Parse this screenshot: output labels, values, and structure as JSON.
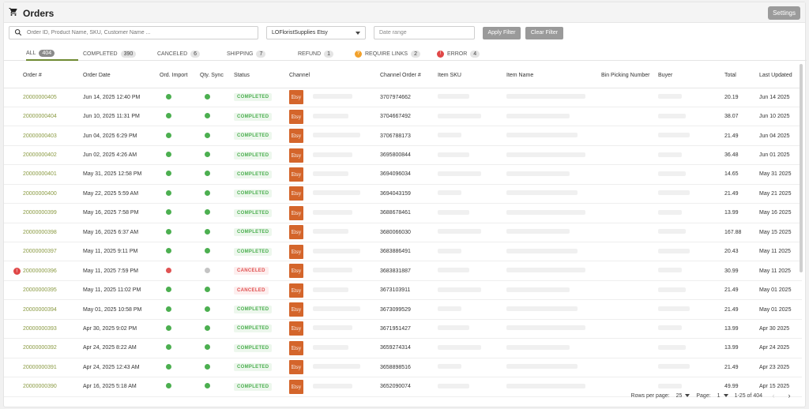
{
  "header": {
    "title": "Orders",
    "settings_label": "Settings"
  },
  "filters": {
    "search_placeholder": "Order ID, Product Name, SKU, Customer Name ...",
    "store_value": "LOFloristSupplies Etsy",
    "date_placeholder": "Date range",
    "apply_label": "Apply Filter",
    "clear_label": "Clear Filter"
  },
  "tabs": [
    {
      "label": "ALL",
      "count": "404"
    },
    {
      "label": "COMPLETED",
      "count": "390"
    },
    {
      "label": "CANCELED",
      "count": "6"
    },
    {
      "label": "SHIPPING",
      "count": "7"
    },
    {
      "label": "REFUND",
      "count": "1"
    },
    {
      "label": "REQUIRE LINKS",
      "count": "2"
    },
    {
      "label": "ERROR",
      "count": "4"
    }
  ],
  "columns": {
    "order": "Order #",
    "order_date": "Order Date",
    "ord_import": "Ord. Import",
    "qty_sync": "Qty. Sync",
    "status": "Status",
    "channel": "Channel",
    "channel_order": "Channel Order #",
    "item_sku": "Item SKU",
    "item_name": "Item Name",
    "bin": "Bin Picking Number",
    "buyer": "Buyer",
    "total": "Total",
    "updated": "Last Updated"
  },
  "channel_logo_text": "Etsy",
  "rows": [
    {
      "order": "20000000405",
      "date": "Jun 14, 2025 12:40 PM",
      "imp": "green",
      "sync": "green",
      "status": "COMPLETED",
      "ch_order": "3707974662",
      "total": "20.19",
      "updated": "Jun 14 2025"
    },
    {
      "order": "20000000404",
      "date": "Jun 10, 2025 11:31 PM",
      "imp": "green",
      "sync": "green",
      "status": "COMPLETED",
      "ch_order": "3704667492",
      "total": "38.07",
      "updated": "Jun 10 2025"
    },
    {
      "order": "20000000403",
      "date": "Jun 04, 2025 6:29 PM",
      "imp": "green",
      "sync": "green",
      "status": "COMPLETED",
      "ch_order": "3706788173",
      "total": "21.49",
      "updated": "Jun 04 2025"
    },
    {
      "order": "20000000402",
      "date": "Jun 02, 2025 4:26 AM",
      "imp": "green",
      "sync": "green",
      "status": "COMPLETED",
      "ch_order": "3695800844",
      "total": "36.48",
      "updated": "Jun 01 2025"
    },
    {
      "order": "20000000401",
      "date": "May 31, 2025 12:58 PM",
      "imp": "green",
      "sync": "green",
      "status": "COMPLETED",
      "ch_order": "3694096034",
      "total": "14.65",
      "updated": "May 31 2025"
    },
    {
      "order": "20000000400",
      "date": "May 22, 2025 5:59 AM",
      "imp": "green",
      "sync": "green",
      "status": "COMPLETED",
      "ch_order": "3694043159",
      "total": "21.49",
      "updated": "May 21 2025"
    },
    {
      "order": "20000000399",
      "date": "May 16, 2025 7:58 PM",
      "imp": "green",
      "sync": "green",
      "status": "COMPLETED",
      "ch_order": "3688678461",
      "total": "13.99",
      "updated": "May 16 2025"
    },
    {
      "order": "20000000398",
      "date": "May 16, 2025 6:37 AM",
      "imp": "green",
      "sync": "green",
      "status": "COMPLETED",
      "ch_order": "3680066030",
      "total": "167.88",
      "updated": "May 15 2025"
    },
    {
      "order": "20000000397",
      "date": "May 11, 2025 9:11 PM",
      "imp": "green",
      "sync": "green",
      "status": "COMPLETED",
      "ch_order": "3683886491",
      "total": "20.43",
      "updated": "May 11 2025"
    },
    {
      "order": "20000000396",
      "date": "May 11, 2025 7:59 PM",
      "imp": "red",
      "sync": "gray",
      "status": "CANCELED",
      "ch_order": "3683831887",
      "total": "30.99",
      "updated": "May 11 2025",
      "error": true
    },
    {
      "order": "20000000395",
      "date": "May 11, 2025 11:02 PM",
      "imp": "green",
      "sync": "green",
      "status": "CANCELED",
      "ch_order": "3673103911",
      "total": "21.49",
      "updated": "May 01 2025"
    },
    {
      "order": "20000000394",
      "date": "May 01, 2025 10:58 PM",
      "imp": "green",
      "sync": "green",
      "status": "COMPLETED",
      "ch_order": "3673099529",
      "total": "21.49",
      "updated": "May 01 2025"
    },
    {
      "order": "20000000393",
      "date": "Apr 30, 2025 9:02 PM",
      "imp": "green",
      "sync": "green",
      "status": "COMPLETED",
      "ch_order": "3671951427",
      "total": "13.99",
      "updated": "Apr 30 2025"
    },
    {
      "order": "20000000392",
      "date": "Apr 24, 2025 8:22 AM",
      "imp": "green",
      "sync": "green",
      "status": "COMPLETED",
      "ch_order": "3659274314",
      "total": "13.99",
      "updated": "Apr 24 2025"
    },
    {
      "order": "20000000391",
      "date": "Apr 24, 2025 12:43 AM",
      "imp": "green",
      "sync": "green",
      "status": "COMPLETED",
      "ch_order": "3658898516",
      "total": "21.49",
      "updated": "Apr 23 2025"
    },
    {
      "order": "20000000390",
      "date": "Apr 16, 2025 5:18 AM",
      "imp": "green",
      "sync": "green",
      "status": "COMPLETED",
      "ch_order": "3652090074",
      "total": "49.99",
      "updated": "Apr 15 2025"
    }
  ],
  "pagination": {
    "rows_label": "Rows per page:",
    "rows_value": "25",
    "page_label": "Page:",
    "page_value": "1",
    "range": "1-25 of 404"
  }
}
